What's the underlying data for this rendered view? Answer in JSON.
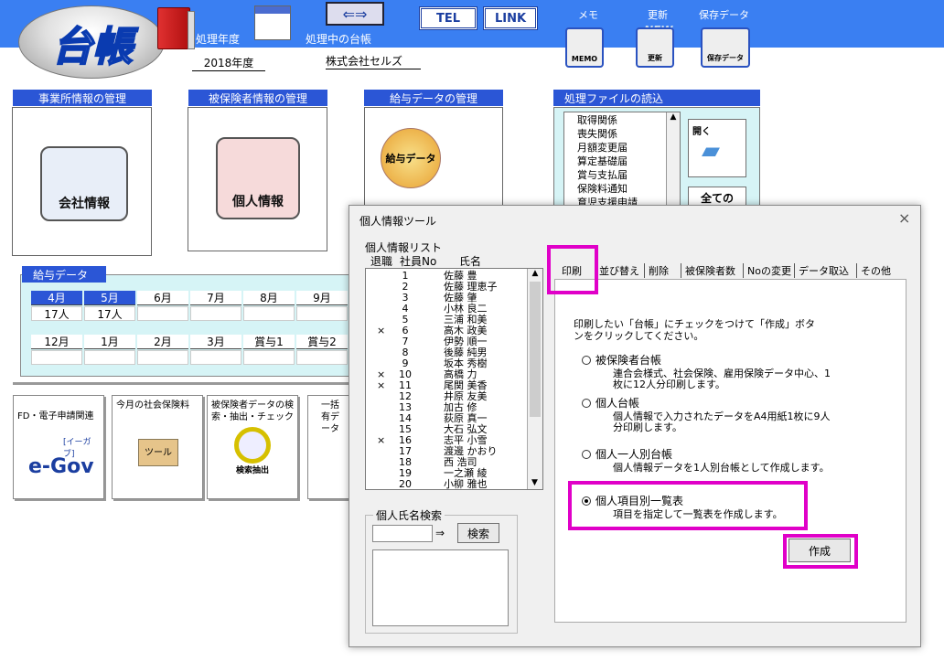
{
  "header": {
    "logo": "台帳",
    "fiscal_year_label": "処理年度",
    "fiscal_year": "2018年度",
    "ledger_label": "処理中の台帳",
    "company": "株式会社セルズ",
    "tel": "TEL",
    "link": "LINK",
    "memo_label": "メモ",
    "memo_icon": "MEMO",
    "update_label": "更新",
    "update_icon": "更新",
    "update_new": "NEW",
    "save_label": "保存データ",
    "save_icon": "保存データ"
  },
  "panels": {
    "office": {
      "title": "事業所情報の管理",
      "button": "会社情報"
    },
    "insured": {
      "title": "被保険者情報の管理",
      "button": "個人情報"
    },
    "salary": {
      "title": "給与データの管理",
      "button": "給与データ"
    },
    "files": {
      "title": "処理ファイルの読込",
      "items": [
        "取得関係",
        "喪失関係",
        "月額変更届",
        "算定基礎届",
        "賞与支払届",
        "保険料通知",
        "育児支援申請"
      ],
      "open": "開く",
      "all": "全ての"
    }
  },
  "salary_data": {
    "title": "給与データ",
    "row1": [
      "4月",
      "5月",
      "6月",
      "7月",
      "8月",
      "9月"
    ],
    "row1_counts": [
      "17人",
      "17人"
    ],
    "row2": [
      "12月",
      "1月",
      "2月",
      "3月",
      "賞与1",
      "賞与2"
    ]
  },
  "tiles": {
    "egov_label": "FD・電子申請関連",
    "egov_logo": "e-Gov",
    "egov_sub": "[イーガブ]",
    "social": "今月の社会保険料",
    "tool": "ツール",
    "search": "被保険者データの検索・抽出・チェック",
    "search_btn": "検索抽出",
    "bulk": "一括有データ"
  },
  "dialog": {
    "title": "個人情報ツール",
    "close": "×",
    "list_title": "個人情報リスト",
    "col_ret": "退職",
    "col_no": "社員No",
    "col_name": "氏名",
    "rows": [
      {
        "m": "",
        "n": "1",
        "name": "佐藤 豊"
      },
      {
        "m": "",
        "n": "2",
        "name": "佐藤 理恵子"
      },
      {
        "m": "",
        "n": "3",
        "name": "佐藤 肇"
      },
      {
        "m": "",
        "n": "4",
        "name": "小林 良二"
      },
      {
        "m": "",
        "n": "5",
        "name": "三浦 和美"
      },
      {
        "m": "×",
        "n": "6",
        "name": "高木 政美"
      },
      {
        "m": "",
        "n": "7",
        "name": "伊勢 順一"
      },
      {
        "m": "",
        "n": "8",
        "name": "後藤 純男"
      },
      {
        "m": "",
        "n": "9",
        "name": "坂本 秀樹"
      },
      {
        "m": "×",
        "n": "10",
        "name": "高橋 力"
      },
      {
        "m": "×",
        "n": "11",
        "name": "尾関 美香"
      },
      {
        "m": "",
        "n": "12",
        "name": "井原 友美"
      },
      {
        "m": "",
        "n": "13",
        "name": "加古 修"
      },
      {
        "m": "",
        "n": "14",
        "name": "荻原 真一"
      },
      {
        "m": "",
        "n": "15",
        "name": "大石 弘文"
      },
      {
        "m": "×",
        "n": "16",
        "name": "志平 小雪"
      },
      {
        "m": "",
        "n": "17",
        "name": "渡邊 かおり"
      },
      {
        "m": "",
        "n": "18",
        "name": "西 浩司"
      },
      {
        "m": "",
        "n": "19",
        "name": "一之瀬 綾"
      },
      {
        "m": "",
        "n": "20",
        "name": "小柳 雅也"
      }
    ],
    "search_title": "個人氏名検索",
    "arrow": "⇒",
    "search_btn": "検索",
    "tabs": [
      "印刷",
      "並び替え",
      "削除",
      "被保険者数",
      "Noの変更",
      "データ取込",
      "その他"
    ],
    "instruction": "印刷したい「台帳」にチェックをつけて「作成」ボタンをクリックしてください。",
    "options": [
      {
        "label": "被保険者台帳",
        "desc": "連合会様式、社会保険、雇用保険データ中心、1枚に12人分印刷します。"
      },
      {
        "label": "個人台帳",
        "desc": "個人情報で入力されたデータをA4用紙1枚に9人分印刷します。"
      },
      {
        "label": "個人一人別台帳",
        "desc": "個人情報データを1人別台帳として作成します。"
      },
      {
        "label": "個人項目別一覧表",
        "desc": "項目を指定して一覧表を作成します。"
      }
    ],
    "create": "作成"
  },
  "colors": {
    "blue": "#3a7ff2",
    "highlight": "#e000c8"
  }
}
